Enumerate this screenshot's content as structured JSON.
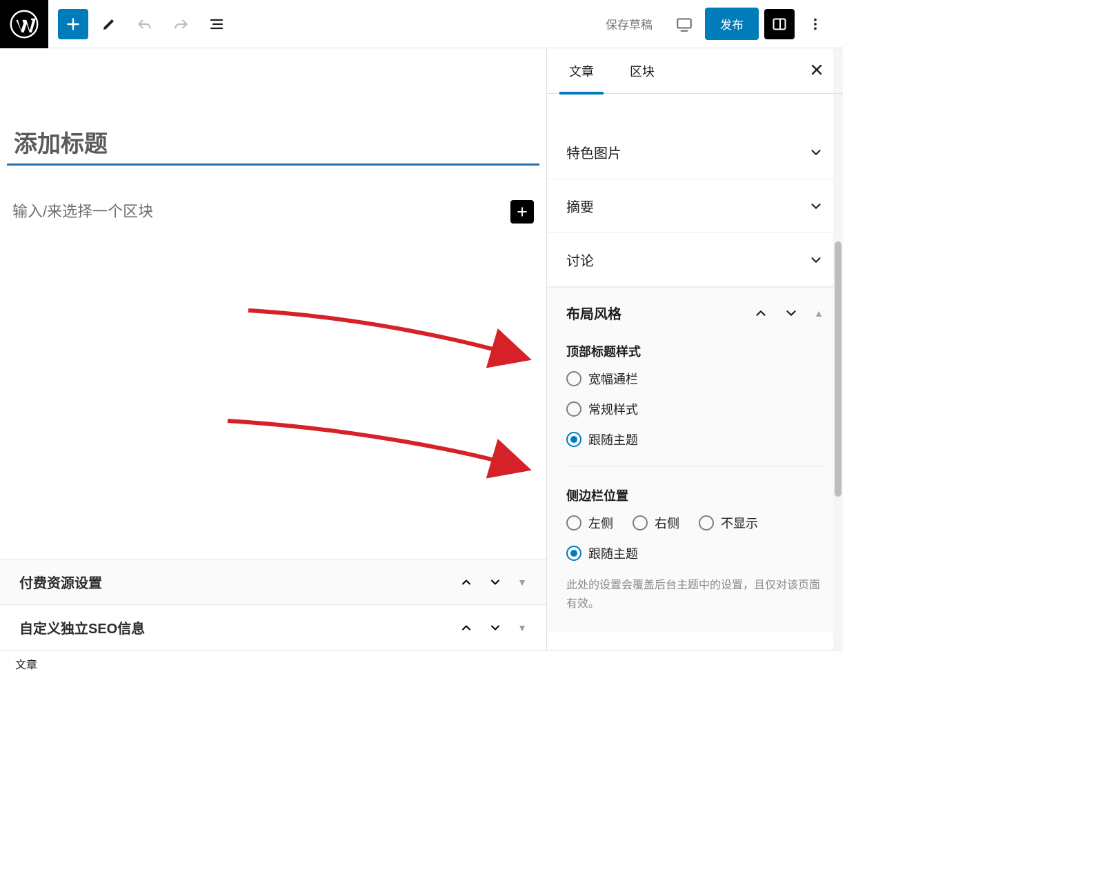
{
  "toolbar": {
    "save_draft": "保存草稿",
    "publish": "发布"
  },
  "editor": {
    "title_placeholder": "添加标题",
    "block_placeholder": "输入/来选择一个区块",
    "accordions": [
      {
        "title": "付费资源设置"
      },
      {
        "title": "自定义独立SEO信息"
      }
    ]
  },
  "sidebar": {
    "tabs": {
      "post": "文章",
      "block": "区块"
    },
    "sections": {
      "featured_image": "特色图片",
      "excerpt": "摘要",
      "discussion": "讨论"
    },
    "layout": {
      "title": "布局风格",
      "top_title_style": {
        "label": "顶部标题样式",
        "options": {
          "wide": "宽幅通栏",
          "standard": "常规样式",
          "follow": "跟随主题"
        },
        "selected": "follow"
      },
      "sidebar_position": {
        "label": "侧边栏位置",
        "options": {
          "left": "左侧",
          "right": "右侧",
          "none": "不显示",
          "follow": "跟随主题"
        },
        "selected": "follow"
      },
      "hint": "此处的设置会覆盖后台主题中的设置，且仅对该页面有效。"
    }
  },
  "footer": {
    "breadcrumb": "文章"
  }
}
